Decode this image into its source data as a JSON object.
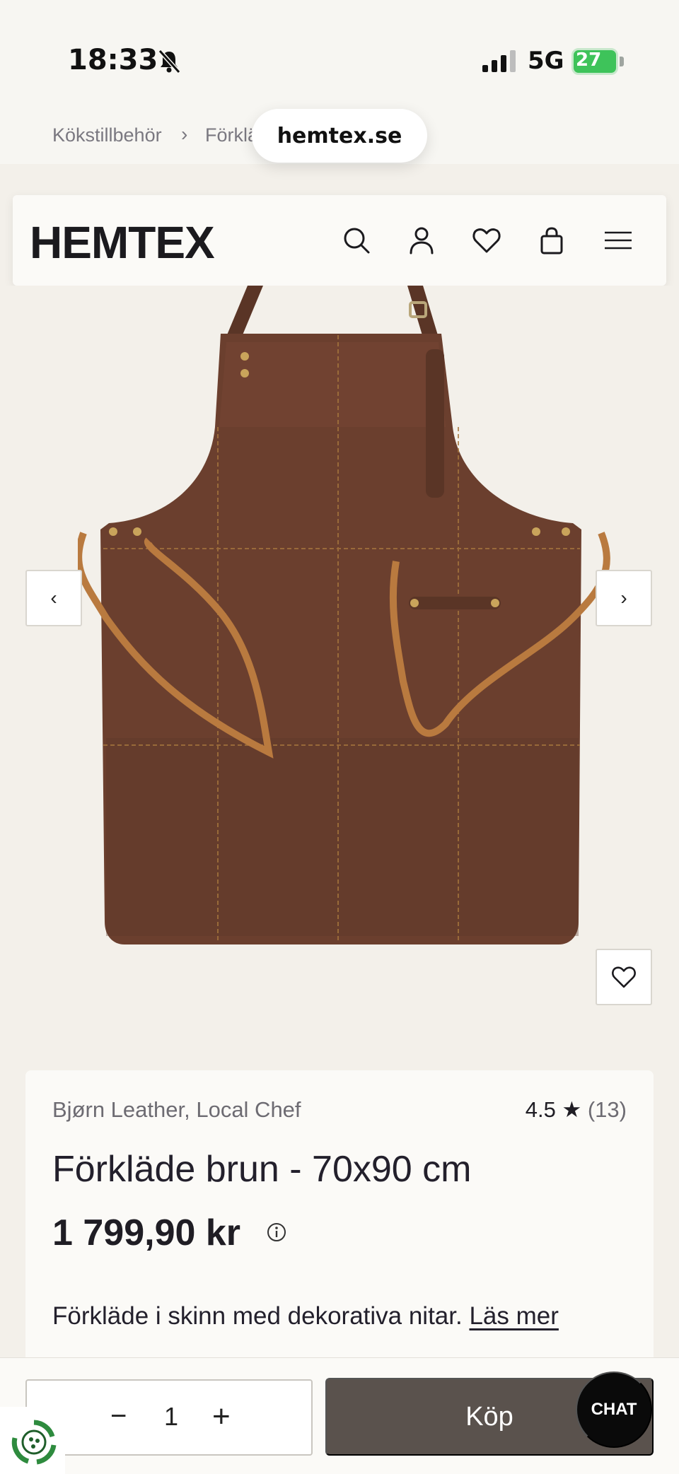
{
  "status_bar": {
    "time": "18:33",
    "network": "5G",
    "battery": "27"
  },
  "browser": {
    "url": "hemtex.se"
  },
  "breadcrumb": {
    "items": [
      "Kökstillbehör",
      "Förklä"
    ],
    "separator": "›"
  },
  "header": {
    "logo": "HEMTEX"
  },
  "gallery": {
    "prev_glyph": "‹",
    "next_glyph": "›"
  },
  "product": {
    "brand": "Bjørn Leather, Local Chef",
    "rating_value": "4.5 ★",
    "rating_count": "(13)",
    "title": "Förkläde brun - 70x90 cm",
    "price": "1 799,90 kr",
    "description": "Förkläde i skinn med dekorativa nitar.",
    "read_more": "Läs mer"
  },
  "purchase": {
    "minus": "−",
    "quantity": "1",
    "plus": "+",
    "buy_label": "Köp",
    "chat_label": "CHAT"
  },
  "colors": {
    "background": "#f3f0ea",
    "buy_button": "#5a524d",
    "leather": "#6b3f2e",
    "strap": "#b97a3f"
  }
}
